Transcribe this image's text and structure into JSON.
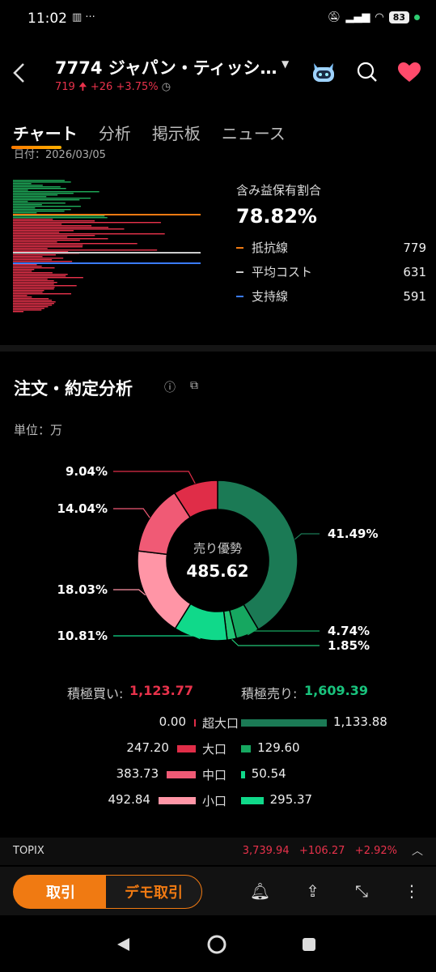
{
  "status_bar": {
    "time": "11:02",
    "battery": "83"
  },
  "header": {
    "title": "7774 ジャパン・ティッシ…",
    "price": "719",
    "change": "+26",
    "change_pct": "+3.75%"
  },
  "tabs": [
    {
      "label": "チャート",
      "active": true
    },
    {
      "label": "分析"
    },
    {
      "label": "掲示板"
    },
    {
      "label": "ニュース"
    }
  ],
  "date_label": "日付：2026/03/05",
  "holding": {
    "label": "含み益保有割合",
    "ratio": "78.82%",
    "lines": [
      {
        "label": "抵抗線",
        "value": "779",
        "color": "#f07a12"
      },
      {
        "label": "平均コスト",
        "value": "631",
        "color": "#cccccc"
      },
      {
        "label": "支持線",
        "value": "591",
        "color": "#3a7bff"
      }
    ]
  },
  "order_section": {
    "title": "注文・約定分析",
    "unit": "単位：万"
  },
  "chart_data": {
    "type": "donut",
    "center_label": "売り優勢",
    "center_value": "485.62",
    "slices": [
      {
        "value": 41.49,
        "label": "41.49%",
        "color": "#1b7a55"
      },
      {
        "value": 4.74,
        "label": "4.74%",
        "color": "#16a760"
      },
      {
        "value": 1.85,
        "label": "1.85%",
        "color": "#22c776"
      },
      {
        "value": 10.81,
        "label": "10.81%",
        "color": "#10d98a"
      },
      {
        "value": 18.03,
        "label": "18.03%",
        "color": "#ff95a6"
      },
      {
        "value": 14.04,
        "label": "14.04%",
        "color": "#f05a75"
      },
      {
        "value": 9.04,
        "label": "9.04%",
        "color": "#e02d48"
      }
    ]
  },
  "summary": {
    "buy_label": "積極買い:",
    "buy_value": "1,123.77",
    "sell_label": "積極売り:",
    "sell_value": "1,609.39"
  },
  "flows": [
    {
      "cat": "超大口",
      "buy": "0.00",
      "sell": "1,133.88",
      "buy_num": 0,
      "sell_num": 1133.88
    },
    {
      "cat": "大口",
      "buy": "247.20",
      "sell": "129.60",
      "buy_num": 247.2,
      "sell_num": 129.6
    },
    {
      "cat": "中口",
      "buy": "383.73",
      "sell": "50.54",
      "buy_num": 383.73,
      "sell_num": 50.54
    },
    {
      "cat": "小口",
      "buy": "492.84",
      "sell": "295.37",
      "buy_num": 492.84,
      "sell_num": 295.37
    }
  ],
  "ticker": {
    "name": "TOPIX",
    "value": "3,739.94",
    "change": "+106.27",
    "pct": "+2.92%"
  },
  "bottom": {
    "trade": "取引",
    "demo": "デモ取引"
  }
}
